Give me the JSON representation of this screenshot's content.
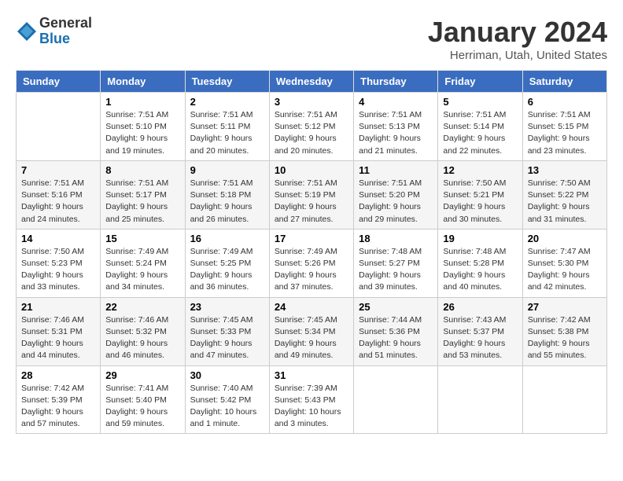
{
  "logo": {
    "general": "General",
    "blue": "Blue"
  },
  "title": "January 2024",
  "subtitle": "Herriman, Utah, United States",
  "days_of_week": [
    "Sunday",
    "Monday",
    "Tuesday",
    "Wednesday",
    "Thursday",
    "Friday",
    "Saturday"
  ],
  "weeks": [
    [
      {
        "day": "",
        "sunrise": "",
        "sunset": "",
        "daylight": ""
      },
      {
        "day": "1",
        "sunrise": "7:51 AM",
        "sunset": "5:10 PM",
        "daylight": "9 hours and 19 minutes."
      },
      {
        "day": "2",
        "sunrise": "7:51 AM",
        "sunset": "5:11 PM",
        "daylight": "9 hours and 20 minutes."
      },
      {
        "day": "3",
        "sunrise": "7:51 AM",
        "sunset": "5:12 PM",
        "daylight": "9 hours and 20 minutes."
      },
      {
        "day": "4",
        "sunrise": "7:51 AM",
        "sunset": "5:13 PM",
        "daylight": "9 hours and 21 minutes."
      },
      {
        "day": "5",
        "sunrise": "7:51 AM",
        "sunset": "5:14 PM",
        "daylight": "9 hours and 22 minutes."
      },
      {
        "day": "6",
        "sunrise": "7:51 AM",
        "sunset": "5:15 PM",
        "daylight": "9 hours and 23 minutes."
      }
    ],
    [
      {
        "day": "7",
        "sunrise": "7:51 AM",
        "sunset": "5:16 PM",
        "daylight": "9 hours and 24 minutes."
      },
      {
        "day": "8",
        "sunrise": "7:51 AM",
        "sunset": "5:17 PM",
        "daylight": "9 hours and 25 minutes."
      },
      {
        "day": "9",
        "sunrise": "7:51 AM",
        "sunset": "5:18 PM",
        "daylight": "9 hours and 26 minutes."
      },
      {
        "day": "10",
        "sunrise": "7:51 AM",
        "sunset": "5:19 PM",
        "daylight": "9 hours and 27 minutes."
      },
      {
        "day": "11",
        "sunrise": "7:51 AM",
        "sunset": "5:20 PM",
        "daylight": "9 hours and 29 minutes."
      },
      {
        "day": "12",
        "sunrise": "7:50 AM",
        "sunset": "5:21 PM",
        "daylight": "9 hours and 30 minutes."
      },
      {
        "day": "13",
        "sunrise": "7:50 AM",
        "sunset": "5:22 PM",
        "daylight": "9 hours and 31 minutes."
      }
    ],
    [
      {
        "day": "14",
        "sunrise": "7:50 AM",
        "sunset": "5:23 PM",
        "daylight": "9 hours and 33 minutes."
      },
      {
        "day": "15",
        "sunrise": "7:49 AM",
        "sunset": "5:24 PM",
        "daylight": "9 hours and 34 minutes."
      },
      {
        "day": "16",
        "sunrise": "7:49 AM",
        "sunset": "5:25 PM",
        "daylight": "9 hours and 36 minutes."
      },
      {
        "day": "17",
        "sunrise": "7:49 AM",
        "sunset": "5:26 PM",
        "daylight": "9 hours and 37 minutes."
      },
      {
        "day": "18",
        "sunrise": "7:48 AM",
        "sunset": "5:27 PM",
        "daylight": "9 hours and 39 minutes."
      },
      {
        "day": "19",
        "sunrise": "7:48 AM",
        "sunset": "5:28 PM",
        "daylight": "9 hours and 40 minutes."
      },
      {
        "day": "20",
        "sunrise": "7:47 AM",
        "sunset": "5:30 PM",
        "daylight": "9 hours and 42 minutes."
      }
    ],
    [
      {
        "day": "21",
        "sunrise": "7:46 AM",
        "sunset": "5:31 PM",
        "daylight": "9 hours and 44 minutes."
      },
      {
        "day": "22",
        "sunrise": "7:46 AM",
        "sunset": "5:32 PM",
        "daylight": "9 hours and 46 minutes."
      },
      {
        "day": "23",
        "sunrise": "7:45 AM",
        "sunset": "5:33 PM",
        "daylight": "9 hours and 47 minutes."
      },
      {
        "day": "24",
        "sunrise": "7:45 AM",
        "sunset": "5:34 PM",
        "daylight": "9 hours and 49 minutes."
      },
      {
        "day": "25",
        "sunrise": "7:44 AM",
        "sunset": "5:36 PM",
        "daylight": "9 hours and 51 minutes."
      },
      {
        "day": "26",
        "sunrise": "7:43 AM",
        "sunset": "5:37 PM",
        "daylight": "9 hours and 53 minutes."
      },
      {
        "day": "27",
        "sunrise": "7:42 AM",
        "sunset": "5:38 PM",
        "daylight": "9 hours and 55 minutes."
      }
    ],
    [
      {
        "day": "28",
        "sunrise": "7:42 AM",
        "sunset": "5:39 PM",
        "daylight": "9 hours and 57 minutes."
      },
      {
        "day": "29",
        "sunrise": "7:41 AM",
        "sunset": "5:40 PM",
        "daylight": "9 hours and 59 minutes."
      },
      {
        "day": "30",
        "sunrise": "7:40 AM",
        "sunset": "5:42 PM",
        "daylight": "10 hours and 1 minute."
      },
      {
        "day": "31",
        "sunrise": "7:39 AM",
        "sunset": "5:43 PM",
        "daylight": "10 hours and 3 minutes."
      },
      {
        "day": "",
        "sunrise": "",
        "sunset": "",
        "daylight": ""
      },
      {
        "day": "",
        "sunrise": "",
        "sunset": "",
        "daylight": ""
      },
      {
        "day": "",
        "sunrise": "",
        "sunset": "",
        "daylight": ""
      }
    ]
  ],
  "labels": {
    "sunrise": "Sunrise:",
    "sunset": "Sunset:",
    "daylight": "Daylight:"
  }
}
